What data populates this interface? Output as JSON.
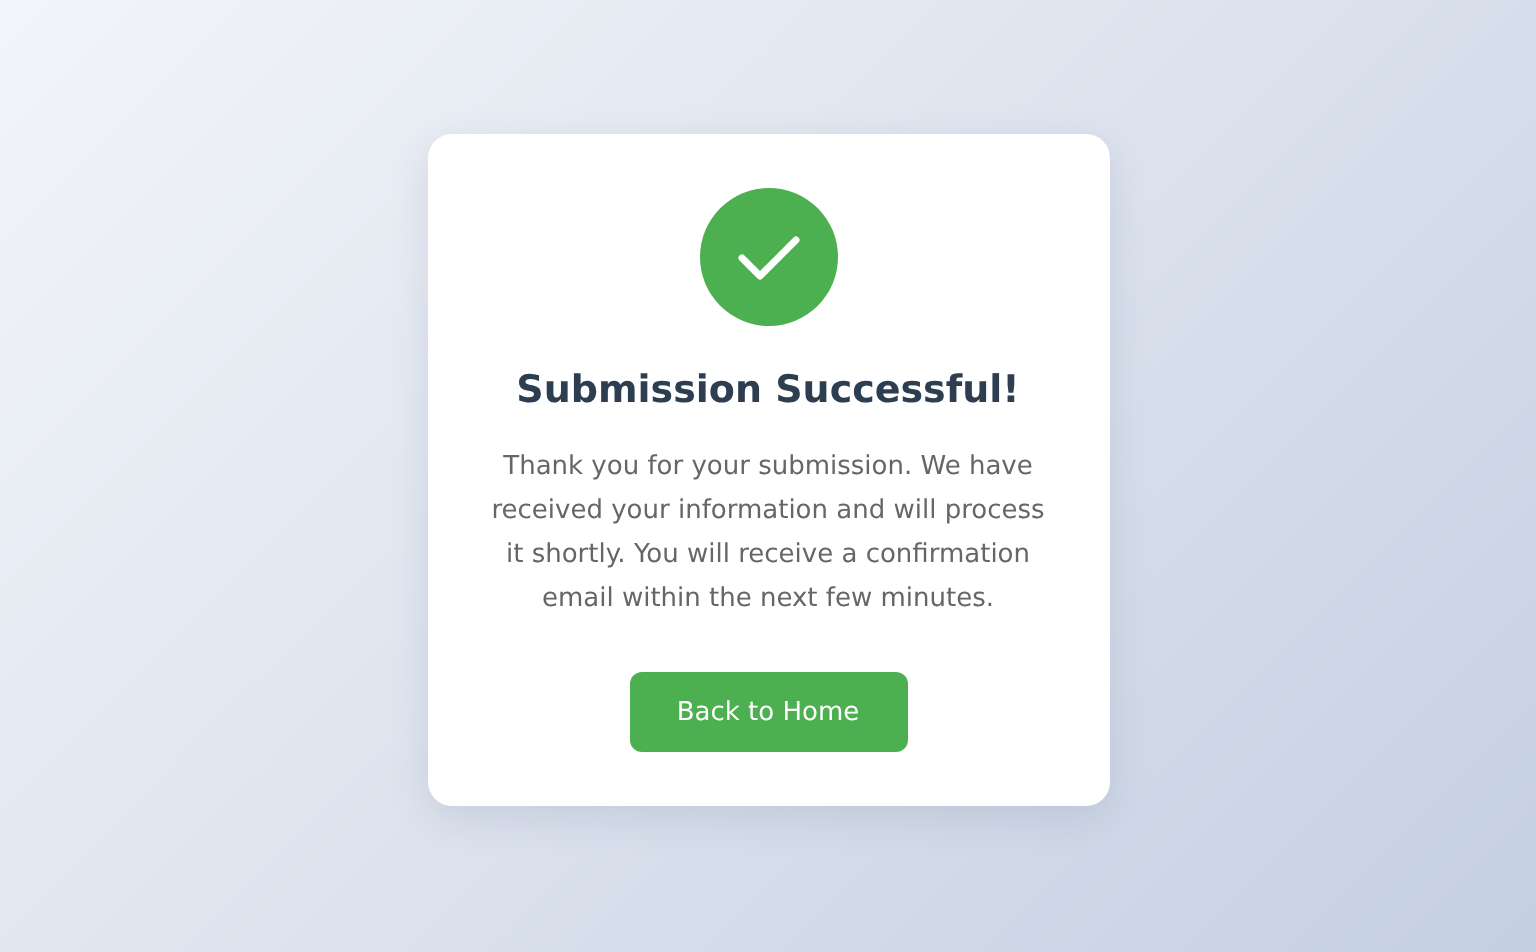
{
  "card": {
    "success": true,
    "title": "Submission Successful!",
    "message": "Thank you for your submission. We have received your information and will process it shortly. You will receive a confirmation email within the next few minutes.",
    "button": "Back to Home"
  }
}
